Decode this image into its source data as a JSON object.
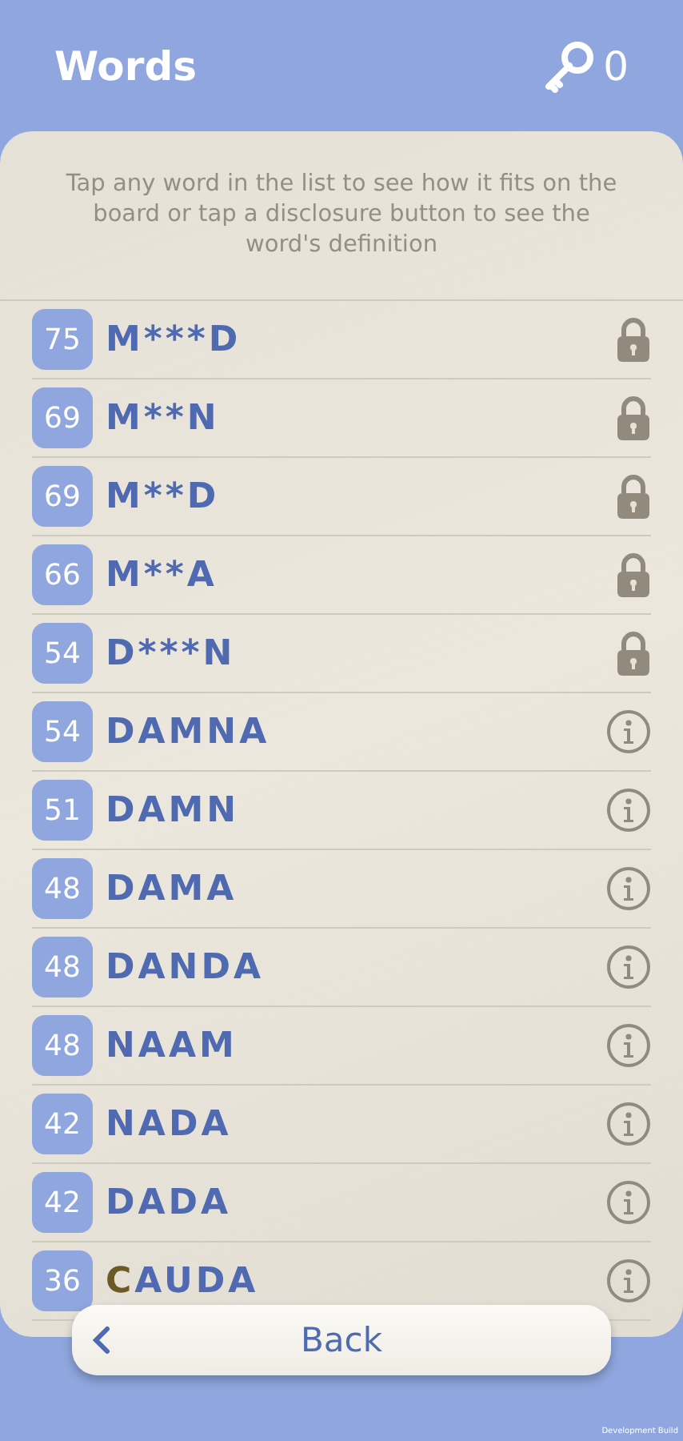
{
  "header": {
    "title": "Words",
    "keys": "0"
  },
  "hint": "Tap any word in the list to see how it fits on the board or tap a disclosure button to see the word's definition",
  "words": [
    {
      "score": "75",
      "kind": "locked",
      "parts": [
        {
          "text": "M***D",
          "highlight": false
        }
      ]
    },
    {
      "score": "69",
      "kind": "locked",
      "parts": [
        {
          "text": "M**N",
          "highlight": false
        }
      ]
    },
    {
      "score": "69",
      "kind": "locked",
      "parts": [
        {
          "text": "M**D",
          "highlight": false
        }
      ]
    },
    {
      "score": "66",
      "kind": "locked",
      "parts": [
        {
          "text": "M**A",
          "highlight": false
        }
      ]
    },
    {
      "score": "54",
      "kind": "locked",
      "parts": [
        {
          "text": "D***N",
          "highlight": false
        }
      ]
    },
    {
      "score": "54",
      "kind": "info",
      "parts": [
        {
          "text": "DAMNA",
          "highlight": false
        }
      ]
    },
    {
      "score": "51",
      "kind": "info",
      "parts": [
        {
          "text": "DAMN",
          "highlight": false
        }
      ]
    },
    {
      "score": "48",
      "kind": "info",
      "parts": [
        {
          "text": "DAMA",
          "highlight": false
        }
      ]
    },
    {
      "score": "48",
      "kind": "info",
      "parts": [
        {
          "text": "DANDA",
          "highlight": false
        }
      ]
    },
    {
      "score": "48",
      "kind": "info",
      "parts": [
        {
          "text": "NAAM",
          "highlight": false
        }
      ]
    },
    {
      "score": "42",
      "kind": "info",
      "parts": [
        {
          "text": "NADA",
          "highlight": false
        }
      ]
    },
    {
      "score": "42",
      "kind": "info",
      "parts": [
        {
          "text": "DADA",
          "highlight": false
        }
      ]
    },
    {
      "score": "36",
      "kind": "info",
      "parts": [
        {
          "text": "C",
          "highlight": true
        },
        {
          "text": "AUDA",
          "highlight": false
        }
      ]
    }
  ],
  "back_button": {
    "label": "Back"
  },
  "build_label": "Development Build"
}
